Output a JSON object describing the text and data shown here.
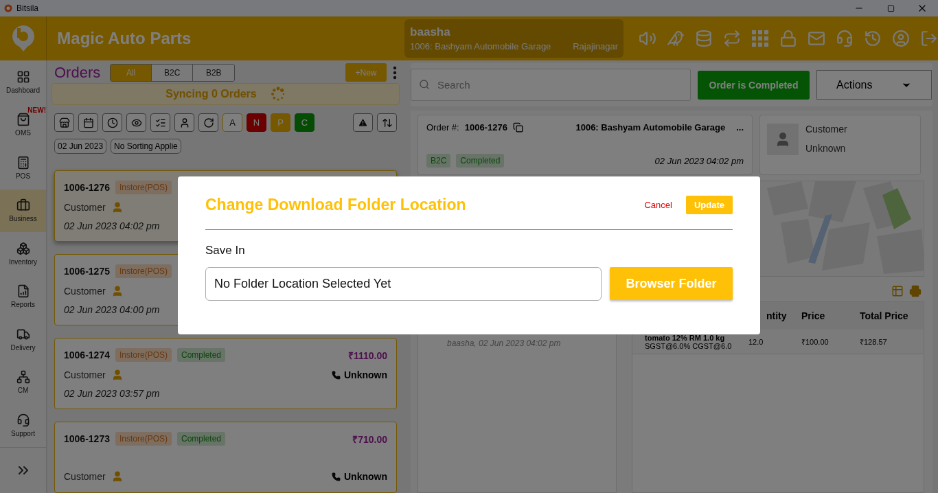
{
  "window": {
    "title": "Bitsila"
  },
  "header": {
    "business": "Magic Auto Parts",
    "user": "baasha",
    "store": "1006: Bashyam Automobile Garage",
    "area": "Rajajinagar"
  },
  "sidebar": {
    "items": [
      {
        "label": "Dashboard",
        "selected": false
      },
      {
        "label": "OMS",
        "badge": "NEW!",
        "selected": false
      },
      {
        "label": "POS",
        "selected": false
      },
      {
        "label": "Business",
        "selected": true
      },
      {
        "label": "Inventory",
        "selected": false
      },
      {
        "label": "Reports",
        "selected": false
      },
      {
        "label": "Delivery",
        "selected": false
      },
      {
        "label": "CM",
        "selected": false
      },
      {
        "label": "Support",
        "selected": false
      }
    ]
  },
  "orders": {
    "title": "Orders",
    "tabs": [
      {
        "label": "All",
        "selected": true
      },
      {
        "label": "B2C",
        "selected": false
      },
      {
        "label": "B2B",
        "selected": false
      }
    ],
    "new_button": "+New",
    "sync_banner": "Syncing 0 Orders",
    "status_filters": [
      {
        "label": "A",
        "kind": "outline"
      },
      {
        "label": "N",
        "kind": "red"
      },
      {
        "label": "P",
        "kind": "gold"
      },
      {
        "label": "C",
        "kind": "green"
      }
    ],
    "chips": [
      "02 Jun 2023",
      "No Sorting Applie"
    ],
    "list": [
      {
        "number": "1006-1276",
        "channel": "Instore(POS)",
        "customer": "Customer",
        "date": "02 Jun 2023 04:02 pm",
        "selected": true
      },
      {
        "number": "1006-1275",
        "channel": "Instore(POS)",
        "customer": "Customer",
        "date": "02 Jun 2023 04:00 pm",
        "selected": false
      },
      {
        "number": "1006-1274",
        "channel": "Instore(POS)",
        "status": "Completed",
        "amount": "₹1110.00",
        "customer": "Customer",
        "phone": "Unknown",
        "date": "02 Jun 2023 03:57 pm",
        "selected": false
      },
      {
        "number": "1006-1273",
        "channel": "Instore(POS)",
        "status": "Completed",
        "amount": "₹710.00",
        "customer": "Customer",
        "phone": "Unknown",
        "selected": false
      }
    ]
  },
  "detail": {
    "search": {
      "placeholder": "Search"
    },
    "status_button": "Order is Completed",
    "actions": "Actions",
    "order": {
      "label": "Order #:",
      "number": "1006-1276",
      "store": "1006: Bashyam Automobile Garage",
      "more": "...",
      "tags": [
        "B2C",
        "Completed"
      ],
      "date": "02 Jun 2023 04:02 pm"
    },
    "customer": {
      "name": "Customer",
      "phone": "Unknown"
    },
    "timeline": [
      "baasha, 02 Jun 2023 04:02 pm"
    ],
    "items": {
      "columns": [
        "ntity",
        "Price",
        "Total Price"
      ],
      "rows": [
        {
          "name": "tomato 12% RM 1.0 kg",
          "tax": "SGST@6.0% CGST@6.0",
          "quantity": "12.0",
          "price": "₹100.00",
          "total": "₹128.57"
        }
      ]
    }
  },
  "dialog": {
    "title": "Change Download Folder Location",
    "cancel": "Cancel",
    "update": "Update",
    "field_label": "Save In",
    "field_value": "No Folder Location Selected Yet",
    "browse": "Browser Folder"
  }
}
